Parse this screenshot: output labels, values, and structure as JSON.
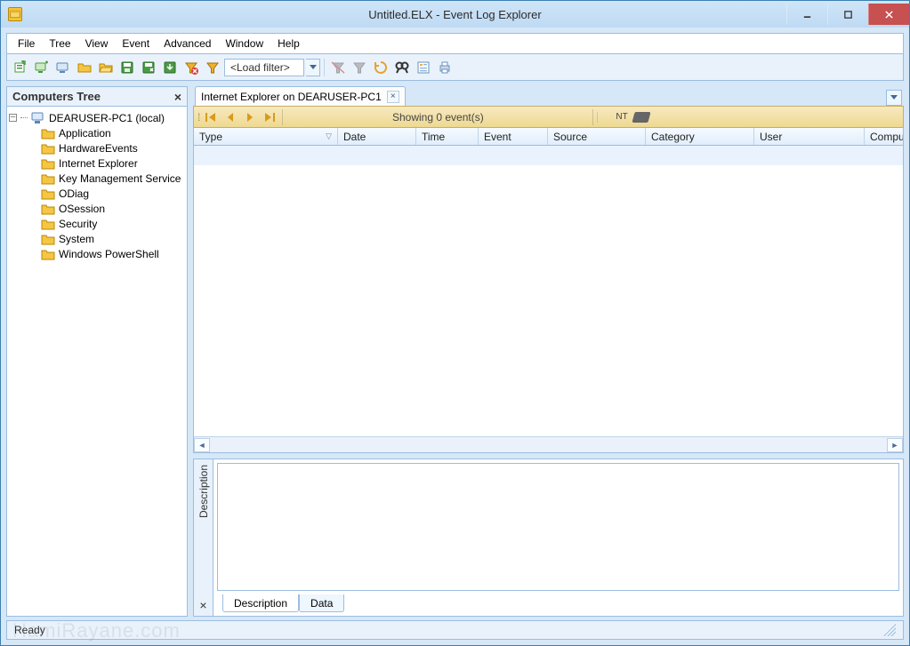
{
  "window": {
    "title": "Untitled.ELX - Event Log Explorer"
  },
  "menu": {
    "items": [
      "File",
      "Tree",
      "View",
      "Event",
      "Advanced",
      "Window",
      "Help"
    ]
  },
  "toolbar": {
    "filter_placeholder": "<Load filter>"
  },
  "tree": {
    "title": "Computers Tree",
    "root": "DEARUSER-PC1 (local)",
    "children": [
      "Application",
      "HardwareEvents",
      "Internet Explorer",
      "Key Management Service",
      "ODiag",
      "OSession",
      "Security",
      "System",
      "Windows PowerShell"
    ]
  },
  "docTab": {
    "label": "Internet Explorer on DEARUSER-PC1"
  },
  "nav": {
    "showing": "Showing 0 event(s)",
    "nt": "NT"
  },
  "grid": {
    "columns": [
      "Type",
      "Date",
      "Time",
      "Event",
      "Source",
      "Category",
      "User",
      "Computer"
    ],
    "widths": [
      162,
      88,
      70,
      78,
      110,
      122,
      124,
      90
    ]
  },
  "descPanel": {
    "title": "Description",
    "tabs": [
      "Description",
      "Data"
    ]
  },
  "status": {
    "text": "Ready"
  },
  "watermark": "HamiRayane.com"
}
